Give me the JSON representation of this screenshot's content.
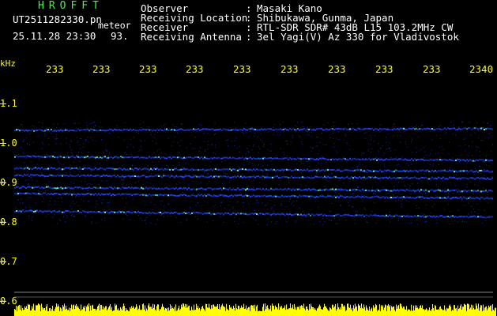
{
  "header": {
    "app_title": "HROFFT",
    "file_name": "UT2511282330.pn",
    "meteor_label": "meteor",
    "datetime": "25.11.28 23:30",
    "count": "93.",
    "fields": [
      {
        "label": "Observer",
        "value": "Masaki Kano"
      },
      {
        "label": "Receiving Location",
        "value": "Shibukawa, Gunma, Japan"
      },
      {
        "label": "Receiver",
        "value": "RTL-SDR SDR# 43dB L15 103.2MHz CW"
      },
      {
        "label": "Receiving Antenna",
        "value": "3el Yagi(V) Az 330 for Vladivostok"
      }
    ]
  },
  "axes": {
    "freq_unit": "kHz",
    "time_ticks": [
      "233",
      "233",
      "233",
      "233",
      "233",
      "233",
      "233",
      "233",
      "233",
      "2340"
    ],
    "freq_ticks": [
      "1.1",
      "1.0",
      "0.9",
      "0.8",
      "0.7",
      "0.6"
    ]
  },
  "colors": {
    "background": "#000000",
    "axis_label": "#ffff00",
    "title": "#33ff33",
    "trace": "#2244ff",
    "trace_hot": "#66ffcc",
    "baseline_bars": "#ffff00"
  }
}
